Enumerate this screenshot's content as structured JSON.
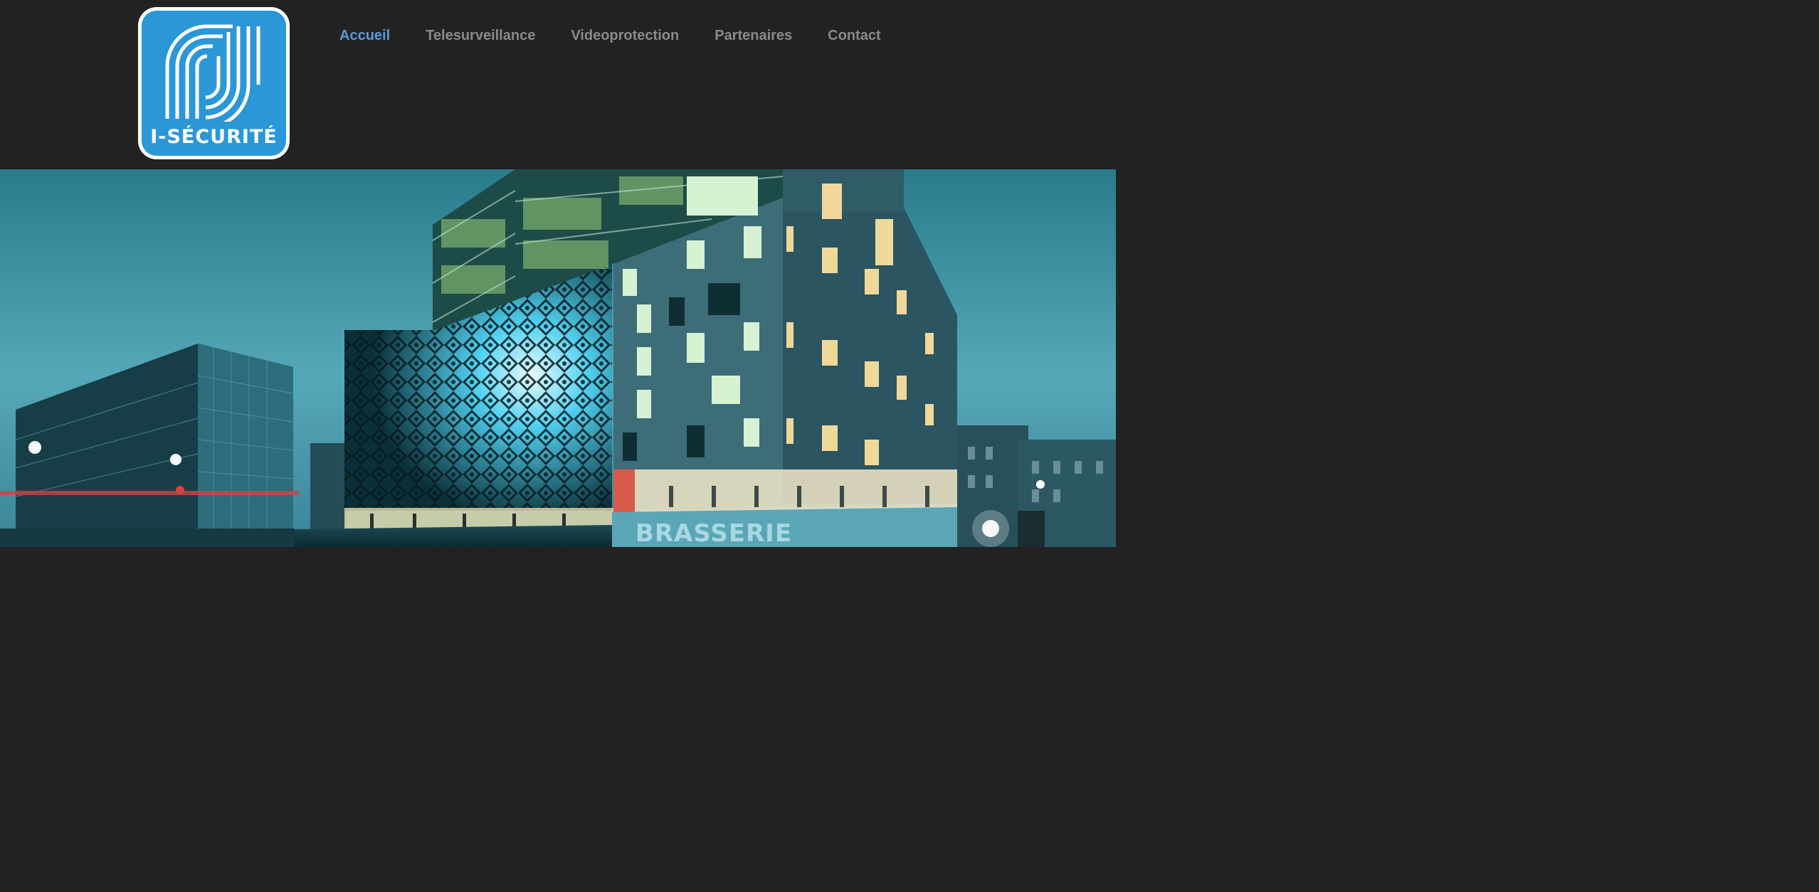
{
  "brand": {
    "logo_text": "I-SÉCURITÉ",
    "logo_color": "#2b97d6"
  },
  "nav": {
    "items": [
      {
        "label": "Accueil",
        "active": true
      },
      {
        "label": "Telesurveillance",
        "active": false
      },
      {
        "label": "Videoprotection",
        "active": false
      },
      {
        "label": "Partenaires",
        "active": false
      },
      {
        "label": "Contact",
        "active": false
      }
    ],
    "active_color": "#5b9ad9",
    "inactive_color": "#8a8a8a"
  },
  "hero": {
    "sign_text": "BRASSERIE"
  },
  "colors": {
    "header_bg": "#222222"
  }
}
